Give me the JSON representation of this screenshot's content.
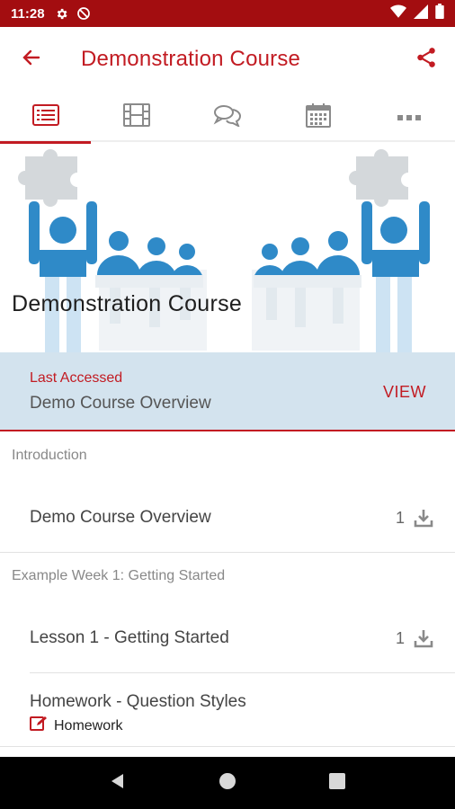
{
  "status_bar": {
    "time": "11:28"
  },
  "app_bar": {
    "title": "Demonstration Course"
  },
  "tabs": [
    {
      "icon": "list-icon",
      "active": true
    },
    {
      "icon": "film-icon",
      "active": false
    },
    {
      "icon": "chat-icon",
      "active": false
    },
    {
      "icon": "calendar-icon",
      "active": false
    },
    {
      "icon": "more-icon",
      "active": false
    }
  ],
  "hero": {
    "title": "Demonstration Course"
  },
  "last_accessed": {
    "label": "Last Accessed",
    "value": "Demo Course Overview",
    "action": "VIEW"
  },
  "sections": [
    {
      "header": "Introduction",
      "items": [
        {
          "label": "Demo Course Overview",
          "count": "1"
        }
      ]
    },
    {
      "header": "Example Week 1: Getting Started",
      "items": [
        {
          "label": "Lesson 1 - Getting Started",
          "count": "1"
        },
        {
          "label": "Homework - Question Styles",
          "sub_label": "Homework"
        }
      ]
    }
  ],
  "colors": {
    "accent": "#c21b22",
    "status_bar": "#a30d10",
    "last_accessed_bg": "#d3e3ee"
  }
}
